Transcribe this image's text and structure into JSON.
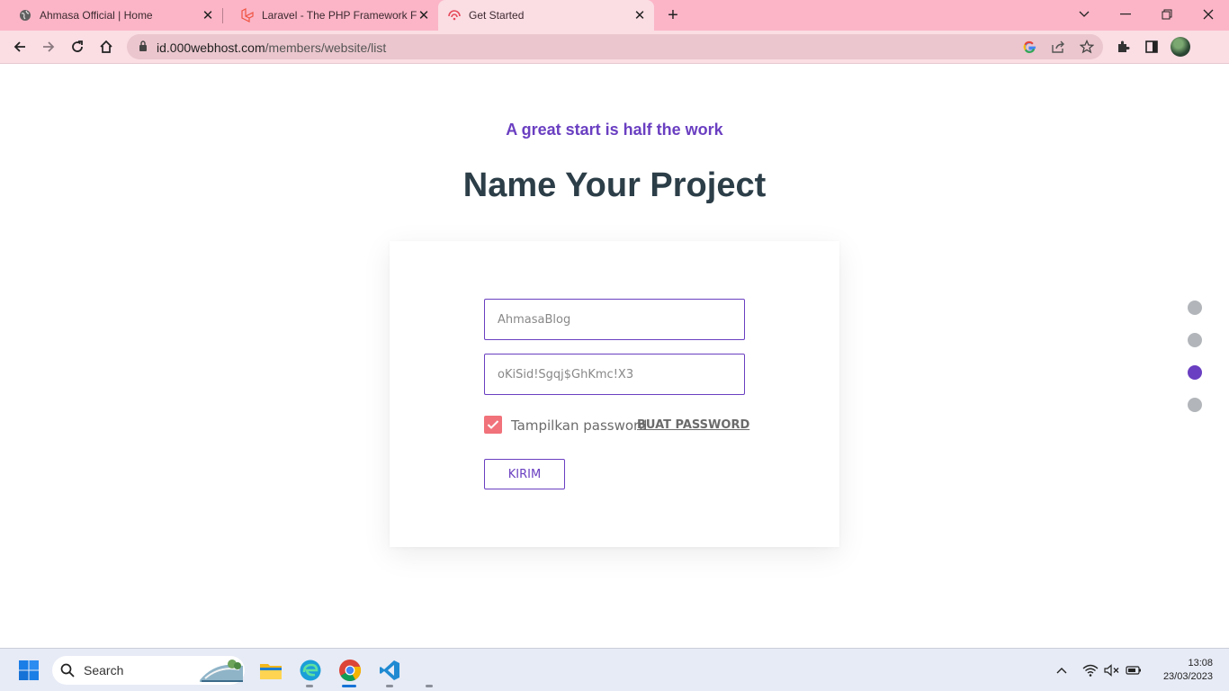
{
  "browser": {
    "tabs": [
      {
        "title": "Ahmasa Official | Home",
        "icon": "globe-icon",
        "active": false
      },
      {
        "title": "Laravel - The PHP Framework For",
        "icon": "laravel-icon",
        "active": false
      },
      {
        "title": "Get Started",
        "icon": "000webhost-icon",
        "active": true
      }
    ],
    "address": {
      "host": "id.000webhost.com",
      "path": "/members/website/list"
    }
  },
  "page": {
    "kicker": "A great start is half the work",
    "title": "Name Your Project",
    "form": {
      "project_name": "AhmasaBlog",
      "password": "oKiSid!Sgqj$GhKmc!X3",
      "show_password_label": "Tampilkan password",
      "show_password_checked": true,
      "generate_password_label": "BUAT PASSWORD",
      "submit_label": "KIRIM"
    },
    "steps": {
      "total": 4,
      "active_index": 2
    }
  },
  "taskbar": {
    "search_label": "Search",
    "time": "13:08",
    "date": "23/03/2023"
  },
  "colors": {
    "accent": "#6a3fc1",
    "tabbar": "#fbb5c7",
    "checkbox": "#f1727a"
  }
}
